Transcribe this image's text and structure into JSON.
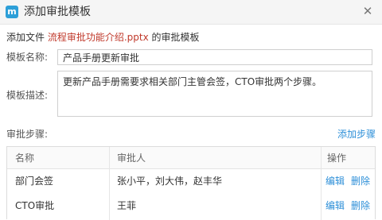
{
  "dialog": {
    "title": "添加审批模板",
    "logo_letter": "m",
    "close_glyph": "✕"
  },
  "subline": {
    "prefix": "添加文件 ",
    "file_name": "流程审批功能介绍.pptx",
    "suffix": " 的审批模板"
  },
  "form": {
    "name_label": "模板名称:",
    "name_value": "产品手册更新审批",
    "desc_label": "模板描述:",
    "desc_value": "更新产品手册需要求相关部门主管会签，CTO审批两个步骤。"
  },
  "steps": {
    "label": "审批步骤:",
    "add_label": "添加步骤",
    "columns": {
      "name": "名称",
      "approver": "审批人",
      "actions": "操作"
    },
    "rows": [
      {
        "name": "部门会签",
        "approver": "张小平，刘大伟，赵丰华",
        "edit": "编辑",
        "delete": "删除"
      },
      {
        "name": "CTO审批",
        "approver": "王菲",
        "edit": "编辑",
        "delete": "删除"
      }
    ]
  },
  "colors": {
    "accent": "#2d8fd8",
    "file_name": "#c0392b",
    "logo": "#2d9fd8"
  }
}
